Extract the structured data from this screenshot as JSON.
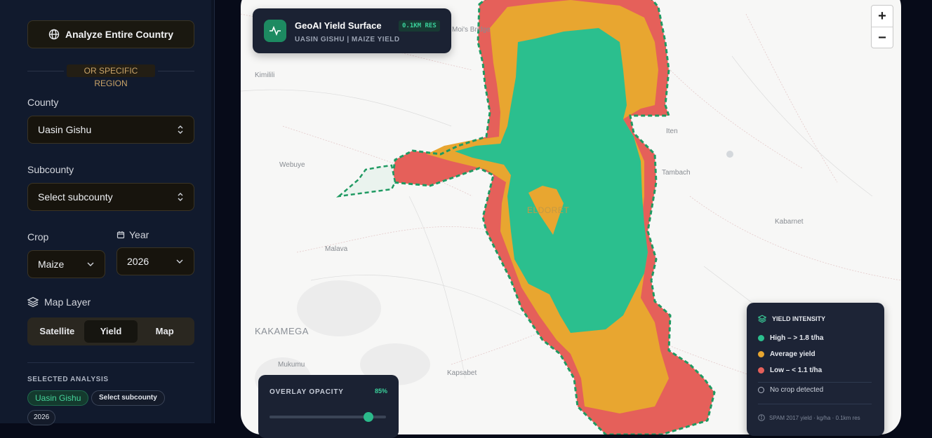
{
  "sidebar": {
    "analyze_button": "Analyze Entire Country",
    "divider_text": "OR SPECIFIC REGION",
    "county": {
      "label": "County",
      "value": "Uasin Gishu"
    },
    "subcounty": {
      "label": "Subcounty",
      "value": "Select subcounty"
    },
    "crop": {
      "label": "Crop",
      "value": "Maize"
    },
    "year": {
      "label": "Year",
      "value": "2026"
    },
    "map_layer": {
      "label": "Map Layer",
      "options": [
        "Satellite",
        "Yield",
        "Map"
      ],
      "active": "Yield"
    },
    "selected_analysis": {
      "title": "SELECTED ANALYSIS",
      "chips": [
        "Uasin Gishu",
        "Select subcounty",
        "2026"
      ]
    }
  },
  "map": {
    "towns": {
      "mois_bridge": "Moi's Bridge",
      "kimilili": "Kimilili",
      "webuye": "Webuye",
      "iten": "Iten",
      "tambach": "Tambach",
      "eldoret": "ELDORET",
      "kabarnet": "Kabarnet",
      "malava": "Malava",
      "kakamega": "KAKAMEGA",
      "mukumu": "Mukumu",
      "kapsabet": "Kapsabet"
    },
    "zoom_in": "+",
    "zoom_out": "−"
  },
  "title_card": {
    "title": "GeoAI Yield Surface",
    "resolution": "0.1KM RES",
    "subtitle": "UASIN GISHU | MAIZE YIELD"
  },
  "legend": {
    "title": "YIELD INTENSITY",
    "items": [
      {
        "label": "High – > 1.8 t/ha",
        "color": "#2bbf8e"
      },
      {
        "label": "Average yield",
        "color": "#e8a630"
      },
      {
        "label": "Low – < 1.1 t/ha",
        "color": "#e5605a"
      },
      {
        "label": "No crop detected",
        "color": "none"
      }
    ],
    "footer": "SPAM 2017 yield · kg/ha · 0.1km res"
  },
  "opacity": {
    "title": "OVERLAY OPACITY",
    "value_label": "85%",
    "value": 0.85
  },
  "colors": {
    "high": "#2bbf8e",
    "average": "#e8a630",
    "low": "#e5605a",
    "boundary": "#1f9a62"
  }
}
